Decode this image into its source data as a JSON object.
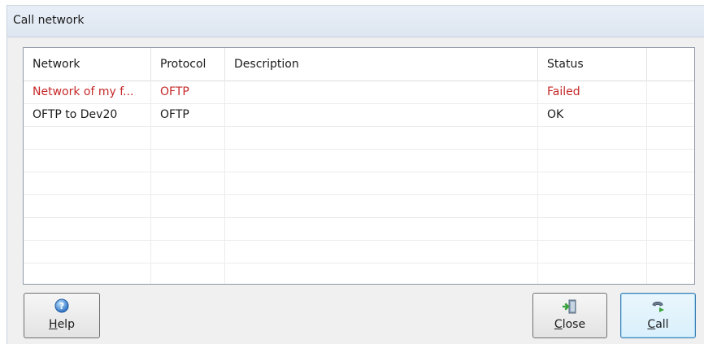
{
  "window": {
    "title": "Call network"
  },
  "table": {
    "columns": [
      "Network",
      "Protocol",
      "Description",
      "Status"
    ],
    "rows": [
      {
        "network": "Network of my f...",
        "protocol": "OFTP",
        "description": "",
        "status": "Failed",
        "state": "error"
      },
      {
        "network": "OFTP to Dev20",
        "protocol": "OFTP",
        "description": "",
        "status": "OK",
        "state": "ok"
      }
    ]
  },
  "buttons": {
    "help": {
      "label": "Help",
      "icon": "help-icon"
    },
    "close": {
      "label": "Close",
      "icon": "exit-icon"
    },
    "call": {
      "label": "Call",
      "icon": "phone-icon"
    }
  },
  "colors": {
    "error": "#c62828",
    "title_bar": "#e3eaf3",
    "default_button_border": "#3c7fb1"
  }
}
